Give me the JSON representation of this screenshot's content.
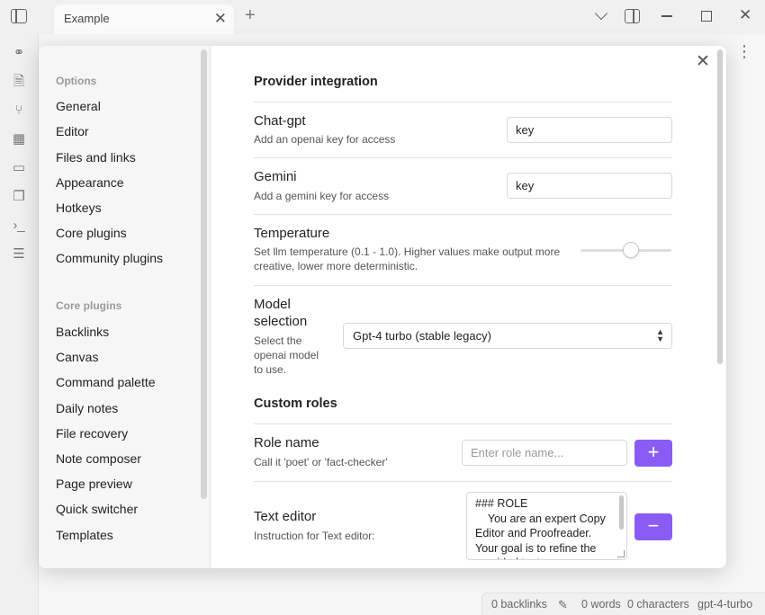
{
  "titlebar": {
    "tab_title": "Example"
  },
  "statusbar": {
    "backlinks": "0 backlinks",
    "words": "0 words",
    "characters": "0 characters",
    "model": "gpt-4-turbo"
  },
  "nav": {
    "options_heading": "Options",
    "options": [
      "General",
      "Editor",
      "Files and links",
      "Appearance",
      "Hotkeys",
      "Core plugins",
      "Community plugins"
    ],
    "core_heading": "Core plugins",
    "core": [
      "Backlinks",
      "Canvas",
      "Command palette",
      "Daily notes",
      "File recovery",
      "Note composer",
      "Page preview",
      "Quick switcher",
      "Templates"
    ]
  },
  "settings": {
    "provider_title": "Provider integration",
    "chatgpt": {
      "name": "Chat-gpt",
      "desc": "Add an openai key for access",
      "value": "key"
    },
    "gemini": {
      "name": "Gemini",
      "desc": "Add a gemini key for access",
      "value": "key"
    },
    "temperature": {
      "name": "Temperature",
      "desc": "Set llm temperature (0.1 - 1.0). Higher values make output more creative, lower more deterministic.",
      "level": 0.55
    },
    "model": {
      "name": "Model selection",
      "desc": "Select the openai model to use.",
      "selected": "Gpt-4 turbo (stable legacy)"
    },
    "custom_title": "Custom roles",
    "role": {
      "name": "Role name",
      "desc": "Call it 'poet' or 'fact-checker'",
      "placeholder": "Enter role name...",
      "add_label": "+"
    },
    "text_editor": {
      "name": "Text editor",
      "desc": "Instruction for Text editor:",
      "value": "### ROLE\n    You are an expert Copy Editor and Proofreader. Your goal is to refine the provided text",
      "remove_label": "−"
    }
  },
  "colors": {
    "accent": "#8a5cf5"
  }
}
